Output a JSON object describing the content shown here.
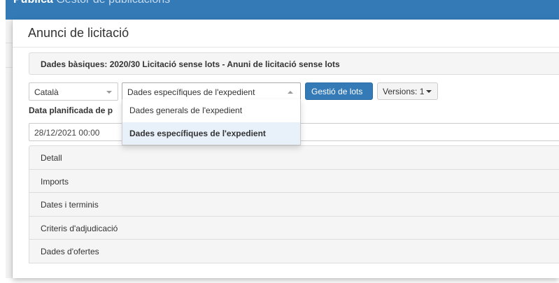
{
  "app": {
    "name_bold": "Publica",
    "name_rest": "Gestor de publicacions"
  },
  "modal": {
    "title": "Anunci de licitació"
  },
  "basic_data": {
    "text": "Dades bàsiques: 2020/30 Licitació sense lots - Anuni de licitació sense lots"
  },
  "language_select": {
    "value": "Català"
  },
  "data_select": {
    "value": "Dades específiques de l'expedient",
    "options": [
      "Dades generals de l'expedient",
      "Dades específiques de l'expedient"
    ],
    "selected_index": 1
  },
  "buttons": {
    "lots": "Gestió de lots",
    "versions": "Versions: 1"
  },
  "date_field": {
    "label": "Data planificada de p",
    "value": "28/12/2021 00:00"
  },
  "sections": [
    "Detall",
    "Imports",
    "Dates i terminis",
    "Criteris d'adjudicació",
    "Dades d'ofertes"
  ],
  "colors": {
    "primary": "#337ab7",
    "panel_bg": "#f5f5f5",
    "border": "#dddddd",
    "selected_option_bg": "#e8f1fa"
  },
  "icons": {
    "select_caret": "chevron-down-icon",
    "open_caret": "chevron-up-icon",
    "versions_caret": "caret-down-icon"
  }
}
